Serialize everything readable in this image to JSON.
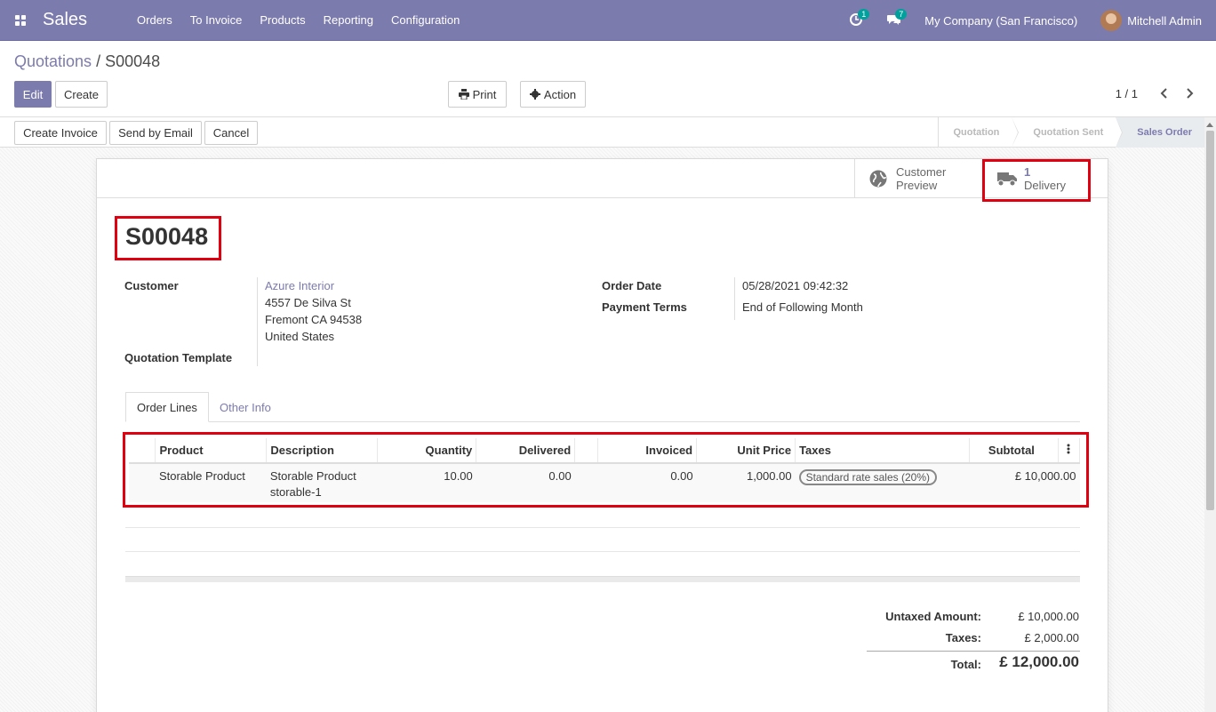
{
  "navbar": {
    "app_name": "Sales",
    "menu": [
      "Orders",
      "To Invoice",
      "Products",
      "Reporting",
      "Configuration"
    ],
    "activity_count": "1",
    "messages_count": "7",
    "company": "My Company (San Francisco)",
    "user": "Mitchell Admin",
    "color": "#7c7bad"
  },
  "breadcrumb": {
    "parent": "Quotations",
    "separator": "/",
    "current": "S00048"
  },
  "toolbar": {
    "edit": "Edit",
    "create": "Create",
    "print": "Print",
    "action": "Action",
    "pager": "1 / 1"
  },
  "statusbar": {
    "buttons": [
      "Create Invoice",
      "Send by Email",
      "Cancel"
    ],
    "stages": [
      "Quotation",
      "Quotation Sent",
      "Sales Order"
    ],
    "active_stage": "Sales Order"
  },
  "smart_buttons": {
    "preview": {
      "line1": "Customer",
      "line2": "Preview"
    },
    "delivery": {
      "count": "1",
      "label": "Delivery"
    }
  },
  "order": {
    "name": "S00048",
    "customer_label": "Customer",
    "customer_name": "Azure Interior",
    "address": [
      "4557 De Silva St",
      "Fremont CA 94538",
      "United States"
    ],
    "template_label": "Quotation Template",
    "date_label": "Order Date",
    "date_value": "05/28/2021 09:42:32",
    "terms_label": "Payment Terms",
    "terms_value": "End of Following Month"
  },
  "tabs": [
    "Order Lines",
    "Other Info"
  ],
  "lines": {
    "headers": [
      "Product",
      "Description",
      "Quantity",
      "Delivered",
      "Invoiced",
      "Unit Price",
      "Taxes",
      "Subtotal"
    ],
    "rows": [
      {
        "product": "Storable Product",
        "description_1": "Storable Product",
        "description_2": "storable-1",
        "quantity": "10.00",
        "delivered": "0.00",
        "invoiced": "0.00",
        "unit_price": "1,000.00",
        "tax": "Standard rate sales (20%)",
        "subtotal": "£ 10,000.00"
      }
    ]
  },
  "totals": {
    "untaxed_label": "Untaxed Amount:",
    "untaxed_value": "£ 10,000.00",
    "taxes_label": "Taxes:",
    "taxes_value": "£ 2,000.00",
    "total_label": "Total:",
    "total_value": "£ 12,000.00"
  }
}
